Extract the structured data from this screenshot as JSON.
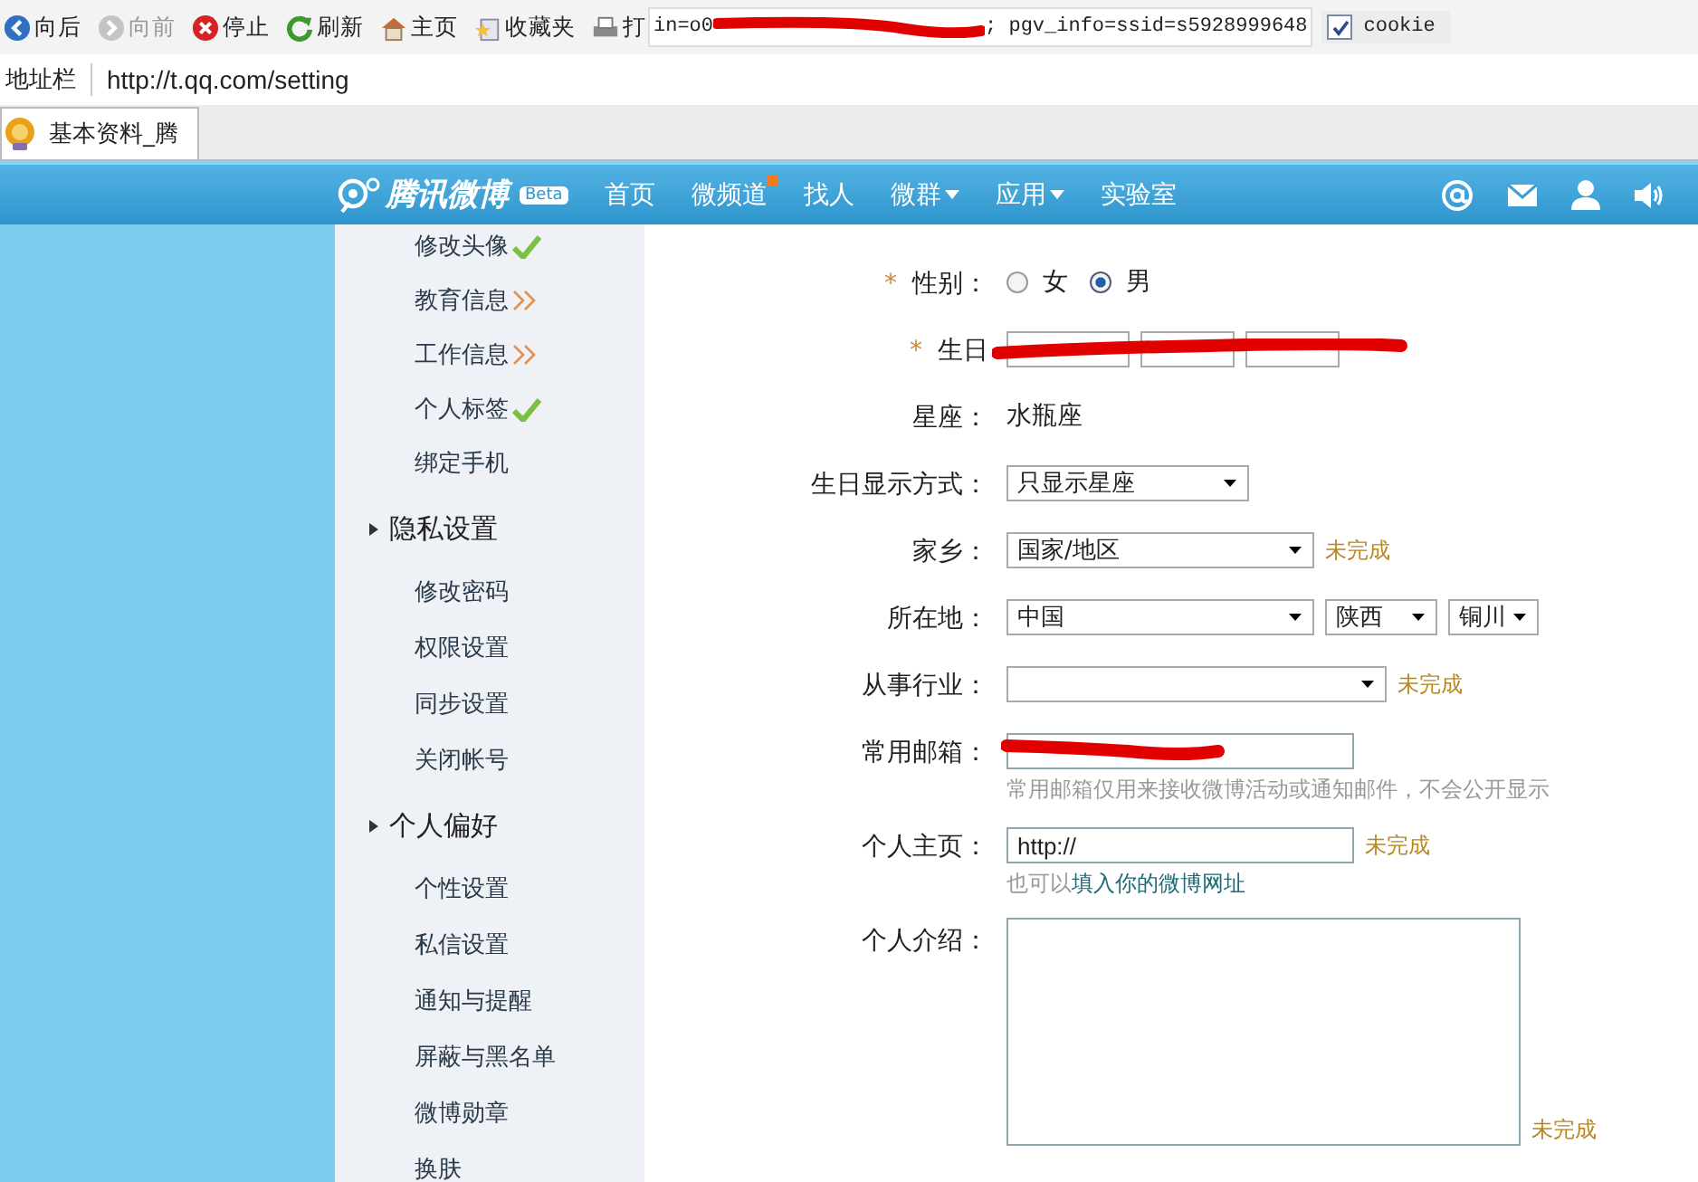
{
  "toolbar": {
    "buttons": [
      {
        "kind": "back",
        "label": "向后",
        "disabled": false
      },
      {
        "kind": "forward",
        "label": "向前",
        "disabled": true
      },
      {
        "kind": "stop",
        "label": "停止",
        "disabled": false
      },
      {
        "kind": "refresh",
        "label": "刷新",
        "disabled": false
      },
      {
        "kind": "home",
        "label": "主页",
        "disabled": false
      },
      {
        "kind": "favorites",
        "label": "收藏夹",
        "disabled": false
      },
      {
        "kind": "print",
        "label": "打",
        "disabled": false
      }
    ],
    "cookie_field": {
      "value_start": "in=o0",
      "value_end": "; pgv_info=ssid=s5928999648"
    },
    "cookie_checkbox": {
      "label": "cookie",
      "checked": true
    }
  },
  "address_bar": {
    "label": "地址栏",
    "url": "http://t.qq.com/setting"
  },
  "tab": {
    "title": "基本资料_腾"
  },
  "site_nav": {
    "logo": "腾讯微博",
    "badge": "Beta",
    "items": [
      {
        "label": "首页",
        "new": false,
        "dropdown": false
      },
      {
        "label": "微频道",
        "new": true,
        "dropdown": false
      },
      {
        "label": "找人",
        "new": false,
        "dropdown": false
      },
      {
        "label": "微群",
        "new": false,
        "dropdown": true
      },
      {
        "label": "应用",
        "new": false,
        "dropdown": true
      },
      {
        "label": "实验室",
        "new": false,
        "dropdown": false
      }
    ]
  },
  "sidebar": {
    "items": [
      {
        "kind": "item",
        "label": "修改头像",
        "completed": true
      },
      {
        "kind": "item",
        "label": "教育信息",
        "completed": false
      },
      {
        "kind": "item",
        "label": "工作信息",
        "completed": false
      },
      {
        "kind": "item",
        "label": "个人标签",
        "completed": true
      },
      {
        "kind": "item",
        "label": "绑定手机"
      },
      {
        "kind": "section",
        "label": "隐私设置"
      },
      {
        "kind": "item",
        "label": "修改密码"
      },
      {
        "kind": "item",
        "label": "权限设置"
      },
      {
        "kind": "item",
        "label": "同步设置"
      },
      {
        "kind": "item",
        "label": "关闭帐号"
      },
      {
        "kind": "section",
        "label": "个人偏好"
      },
      {
        "kind": "item",
        "label": "个性设置"
      },
      {
        "kind": "item",
        "label": "私信设置"
      },
      {
        "kind": "item",
        "label": "通知与提醒"
      },
      {
        "kind": "item",
        "label": "屏蔽与黑名单"
      },
      {
        "kind": "item",
        "label": "微博勋章"
      },
      {
        "kind": "item",
        "label": "换肤"
      }
    ]
  },
  "form": {
    "rows": [
      {
        "kind": "radio",
        "label": "性别：",
        "marker": "*",
        "options": [
          {
            "label": "女",
            "selected": false
          },
          {
            "label": "男",
            "selected": true
          }
        ]
      },
      {
        "kind": "birthday",
        "label": "生日",
        "marker": "*"
      },
      {
        "kind": "text",
        "label": "星座：",
        "value": "水瓶座"
      },
      {
        "kind": "select",
        "label": "生日显示方式：",
        "selects": [
          {
            "value": "只显示星座"
          }
        ]
      },
      {
        "kind": "select",
        "label": "家乡：",
        "selects": [
          {
            "value": "国家/地区"
          }
        ],
        "note": "未完成"
      },
      {
        "kind": "select",
        "label": "所在地：",
        "selects": [
          {
            "value": "中国"
          },
          {
            "value": "陕西"
          },
          {
            "value": "铜川"
          }
        ]
      },
      {
        "kind": "select",
        "label": "从事行业：",
        "note": "未完成"
      },
      {
        "kind": "input",
        "label": "常用邮箱：",
        "redacted": true,
        "hint": "常用邮箱仅用来接收微博活动或通知邮件，不会公开显示"
      },
      {
        "kind": "input",
        "label": "个人主页：",
        "value": "http://",
        "note": "未完成",
        "hint": "也可以",
        "hint_link": "填入你的微博网址"
      },
      {
        "kind": "textarea",
        "label": "个人介绍：",
        "note": "未完成"
      }
    ]
  }
}
